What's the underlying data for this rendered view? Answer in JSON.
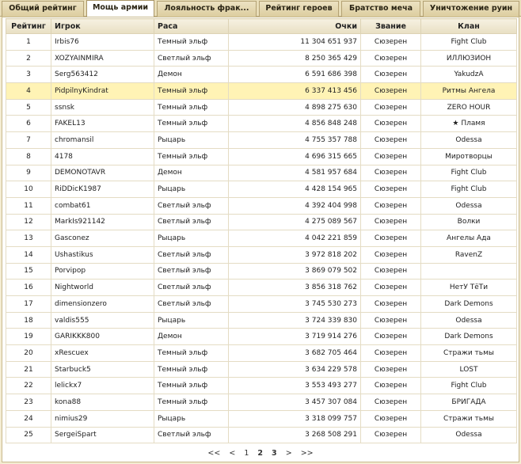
{
  "tabs": [
    {
      "label": "Общий рейтинг"
    },
    {
      "label": "Мощь армии",
      "active": true
    },
    {
      "label": "Лояльность фрак..."
    },
    {
      "label": "Рейтинг героев"
    },
    {
      "label": "Братство меча"
    },
    {
      "label": "Уничтожение руин"
    }
  ],
  "table": {
    "headers": {
      "rank": "Рейтинг",
      "player": "Игрок",
      "race": "Раса",
      "points": "Очки",
      "title": "Звание",
      "clan": "Клан"
    },
    "highlight_rank": "4",
    "rows": [
      {
        "rank": "1",
        "player": "Irbis76",
        "race": "Темный эльф",
        "points": "11 304 651 937",
        "title": "Сюзерен",
        "clan": "Fight Club"
      },
      {
        "rank": "2",
        "player": "XOZYAINMIRA",
        "race": "Светлый эльф",
        "points": "8 250 365 429",
        "title": "Сюзерен",
        "clan": "ИЛЛЮЗИОН"
      },
      {
        "rank": "3",
        "player": "Serg563412",
        "race": "Демон",
        "points": "6 591 686 398",
        "title": "Сюзерен",
        "clan": "YakudzA"
      },
      {
        "rank": "4",
        "player": "PidpilnyKindrat",
        "race": "Темный эльф",
        "points": "6 337 413 456",
        "title": "Сюзерен",
        "clan": "Ритмы Ангела"
      },
      {
        "rank": "5",
        "player": "ssnsk",
        "race": "Темный эльф",
        "points": "4 898 275 630",
        "title": "Сюзерен",
        "clan": "ZERO HOUR"
      },
      {
        "rank": "6",
        "player": "FAKEL13",
        "race": "Темный эльф",
        "points": "4 856 848 248",
        "title": "Сюзерен",
        "clan": "★ Пламя"
      },
      {
        "rank": "7",
        "player": "chromansil",
        "race": "Рыцарь",
        "points": "4 755 357 788",
        "title": "Сюзерен",
        "clan": "Odessa"
      },
      {
        "rank": "8",
        "player": "4178",
        "race": "Темный эльф",
        "points": "4 696 315 665",
        "title": "Сюзерен",
        "clan": "Миротворцы"
      },
      {
        "rank": "9",
        "player": "DEMONOTAVR",
        "race": "Демон",
        "points": "4 581 957 684",
        "title": "Сюзерен",
        "clan": "Fight Club"
      },
      {
        "rank": "10",
        "player": "RiDDicK1987",
        "race": "Рыцарь",
        "points": "4 428 154 965",
        "title": "Сюзерен",
        "clan": "Fight Club"
      },
      {
        "rank": "11",
        "player": "combat61",
        "race": "Светлый эльф",
        "points": "4 392 404 998",
        "title": "Сюзерен",
        "clan": "Odessa"
      },
      {
        "rank": "12",
        "player": "MarkIs921142",
        "race": "Светлый эльф",
        "points": "4 275 089 567",
        "title": "Сюзерен",
        "clan": "Волки"
      },
      {
        "rank": "13",
        "player": "Gasconez",
        "race": "Рыцарь",
        "points": "4 042 221 859",
        "title": "Сюзерен",
        "clan": "Ангелы Ада"
      },
      {
        "rank": "14",
        "player": "Ushastikus",
        "race": "Светлый эльф",
        "points": "3 972 818 202",
        "title": "Сюзерен",
        "clan": "RavenZ"
      },
      {
        "rank": "15",
        "player": "Porvipop",
        "race": "Светлый эльф",
        "points": "3 869 079 502",
        "title": "Сюзерен",
        "clan": ""
      },
      {
        "rank": "16",
        "player": "Nightworld",
        "race": "Светлый эльф",
        "points": "3 856 318 762",
        "title": "Сюзерен",
        "clan": "НетУ ТёТи"
      },
      {
        "rank": "17",
        "player": "dimensionzero",
        "race": "Светлый эльф",
        "points": "3 745 530 273",
        "title": "Сюзерен",
        "clan": "Dark Demons"
      },
      {
        "rank": "18",
        "player": "valdis555",
        "race": "Рыцарь",
        "points": "3 724 339 830",
        "title": "Сюзерен",
        "clan": "Odessa"
      },
      {
        "rank": "19",
        "player": "GARIKKK800",
        "race": "Демон",
        "points": "3 719 914 276",
        "title": "Сюзерен",
        "clan": "Dark Demons"
      },
      {
        "rank": "20",
        "player": "xRescuex",
        "race": "Темный эльф",
        "points": "3 682 705 464",
        "title": "Сюзерен",
        "clan": "Стражи тьмы"
      },
      {
        "rank": "21",
        "player": "Starbuck5",
        "race": "Темный эльф",
        "points": "3 634 229 578",
        "title": "Сюзерен",
        "clan": "LOST"
      },
      {
        "rank": "22",
        "player": "lelickx7",
        "race": "Темный эльф",
        "points": "3 553 493 277",
        "title": "Сюзерен",
        "clan": "Fight Club"
      },
      {
        "rank": "23",
        "player": "kona88",
        "race": "Темный эльф",
        "points": "3 457 307 084",
        "title": "Сюзерен",
        "clan": "БРИГАДА"
      },
      {
        "rank": "24",
        "player": "nimius29",
        "race": "Рыцарь",
        "points": "3 318 099 757",
        "title": "Сюзерен",
        "clan": "Стражи тьмы"
      },
      {
        "rank": "25",
        "player": "SergeiSpart",
        "race": "Светлый эльф",
        "points": "3 268 508 291",
        "title": "Сюзерен",
        "clan": "Odessa"
      }
    ]
  },
  "pager": {
    "first": "<<",
    "prev": "<",
    "pages": [
      "1",
      "2",
      "3"
    ],
    "current": "2",
    "next": ">",
    "last": ">>"
  },
  "colors": {
    "highlight_row": "#fff3b5",
    "background": "#f4ecd2"
  }
}
